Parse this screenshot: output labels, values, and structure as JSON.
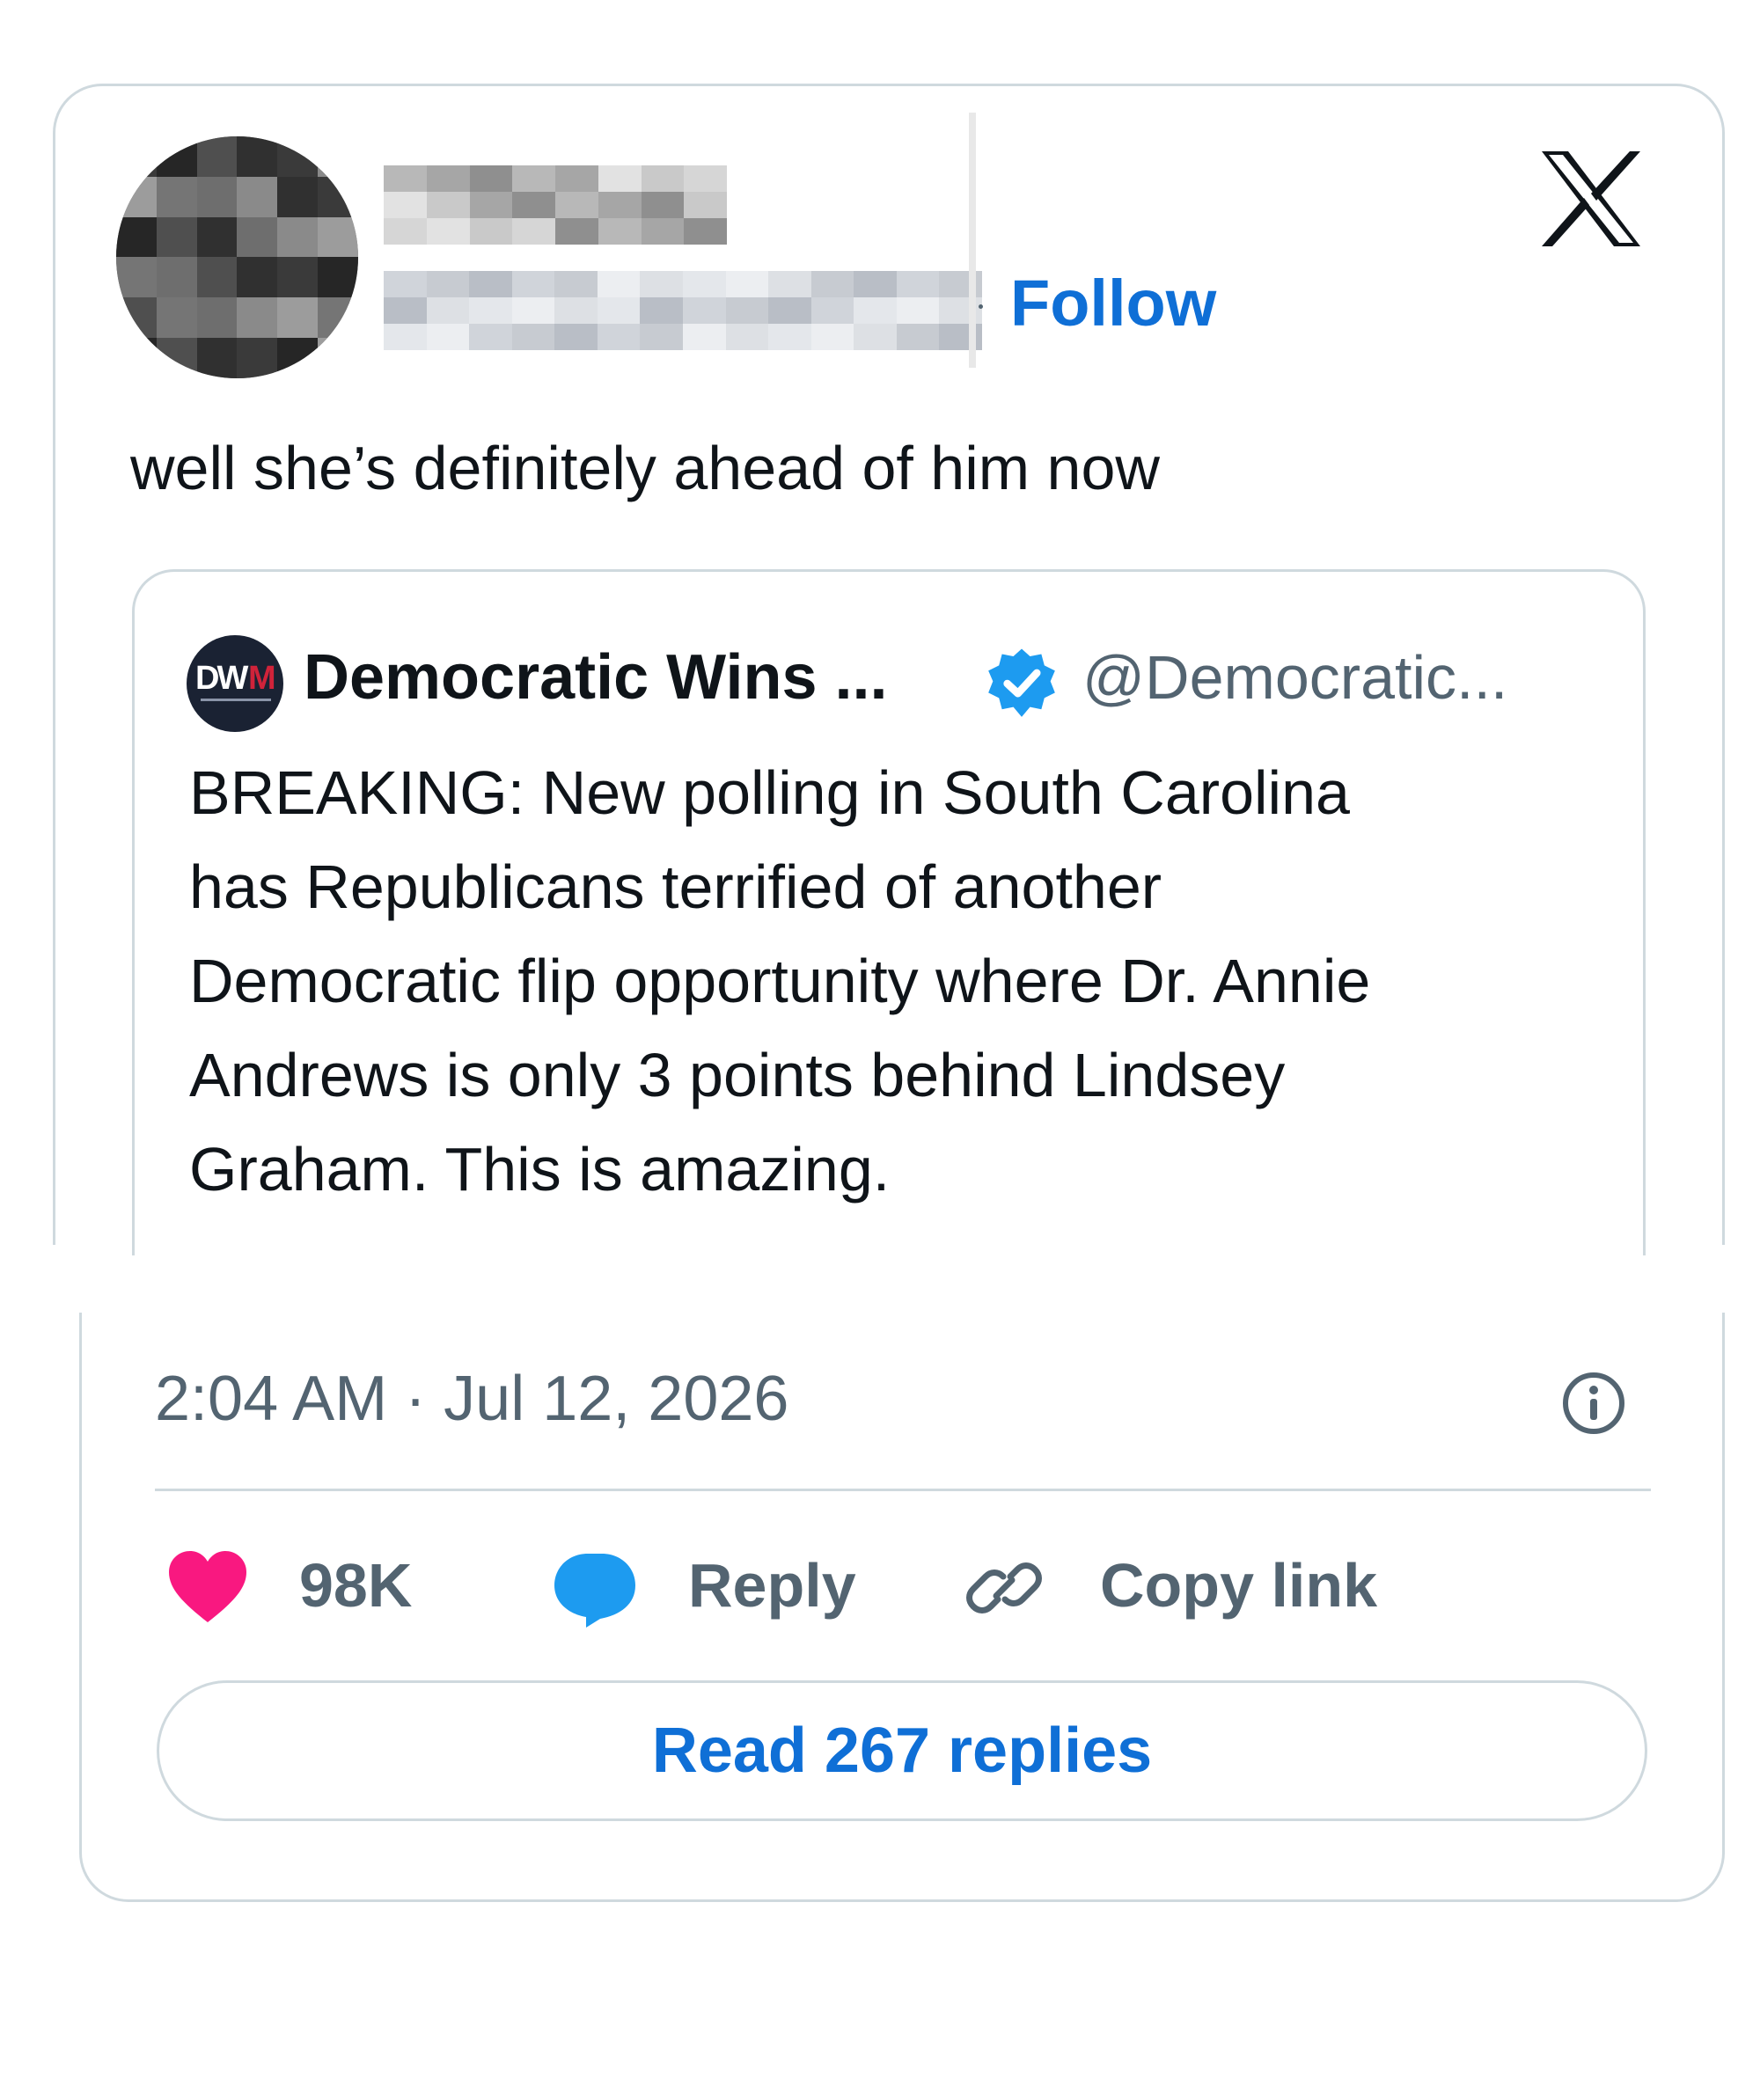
{
  "post": {
    "follow_label": "Follow",
    "text": "well she’s definitely ahead of him now"
  },
  "quoted_post": {
    "avatar_text_primary": "DW",
    "avatar_text_accent": "M",
    "author_name": "Democratic Wins ...",
    "handle": "@Democratic...",
    "verified": true,
    "lines": [
      "BREAKING: New polling in South Carolina",
      "has Republicans terrified of another",
      "Democratic flip opportunity where Dr. Annie",
      "Andrews is only 3 points behind Lindsey",
      "Graham. This is amazing."
    ]
  },
  "meta": {
    "timestamp": "2:04 AM · Jul 12, 2026"
  },
  "actions": {
    "likes": "98K",
    "reply_label": "Reply",
    "copy_link_label": "Copy link",
    "read_replies_label": "Read 267 replies"
  },
  "colors": {
    "accent_blue": "#0f6fd6",
    "heart_pink": "#f91880",
    "bubble_blue": "#1d9bf0",
    "border": "#cfd9de",
    "muted_text": "#536471"
  },
  "icons": [
    "x-logo-icon",
    "verified-badge-icon",
    "info-icon",
    "heart-icon",
    "reply-bubble-icon",
    "link-icon"
  ]
}
